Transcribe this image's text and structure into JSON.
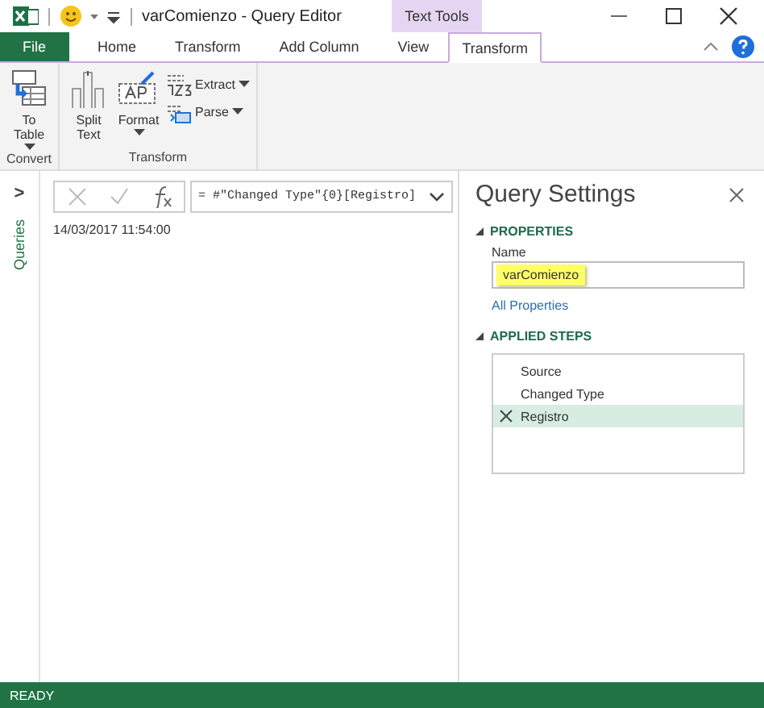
{
  "window": {
    "title": "varComienzo - Query Editor",
    "context_label": "Text Tools"
  },
  "tabs": [
    {
      "label": "File",
      "kind": "file",
      "selected": false
    },
    {
      "label": "Home",
      "kind": "normal",
      "selected": false
    },
    {
      "label": "Transform",
      "kind": "normal",
      "selected": false
    },
    {
      "label": "Add Column",
      "kind": "normal",
      "selected": false
    },
    {
      "label": "View",
      "kind": "normal",
      "selected": false
    },
    {
      "label": "Transform",
      "kind": "contextual",
      "selected": true
    }
  ],
  "ribbon_groups": [
    {
      "label": "Convert",
      "buttons": [
        {
          "label": "To Table",
          "kind": "large",
          "dropdown": true
        }
      ]
    },
    {
      "label": "Transform",
      "buttons": [
        {
          "label": "Split Text",
          "kind": "large",
          "dropdown": false
        },
        {
          "label": "Format",
          "kind": "large",
          "dropdown": true
        },
        {
          "label": "Extract",
          "kind": "small",
          "dropdown": true
        },
        {
          "label": "Parse",
          "kind": "small",
          "dropdown": true
        }
      ]
    }
  ],
  "sidebar": {
    "expand": ">",
    "label": "Queries"
  },
  "formula_bar": {
    "formula": "= #\"Changed Type\"{0}[Registro]"
  },
  "result": "14/03/2017 11:54:00",
  "query_settings": {
    "title": "Query Settings",
    "properties_heading": "PROPERTIES",
    "name_label": "Name",
    "name_value": "varComienzo",
    "all_properties": "All Properties",
    "steps_heading": "APPLIED STEPS",
    "steps": [
      {
        "label": "Source",
        "selected": false
      },
      {
        "label": "Changed Type",
        "selected": false
      },
      {
        "label": "Registro",
        "selected": true
      }
    ]
  },
  "status_bar": "READY"
}
